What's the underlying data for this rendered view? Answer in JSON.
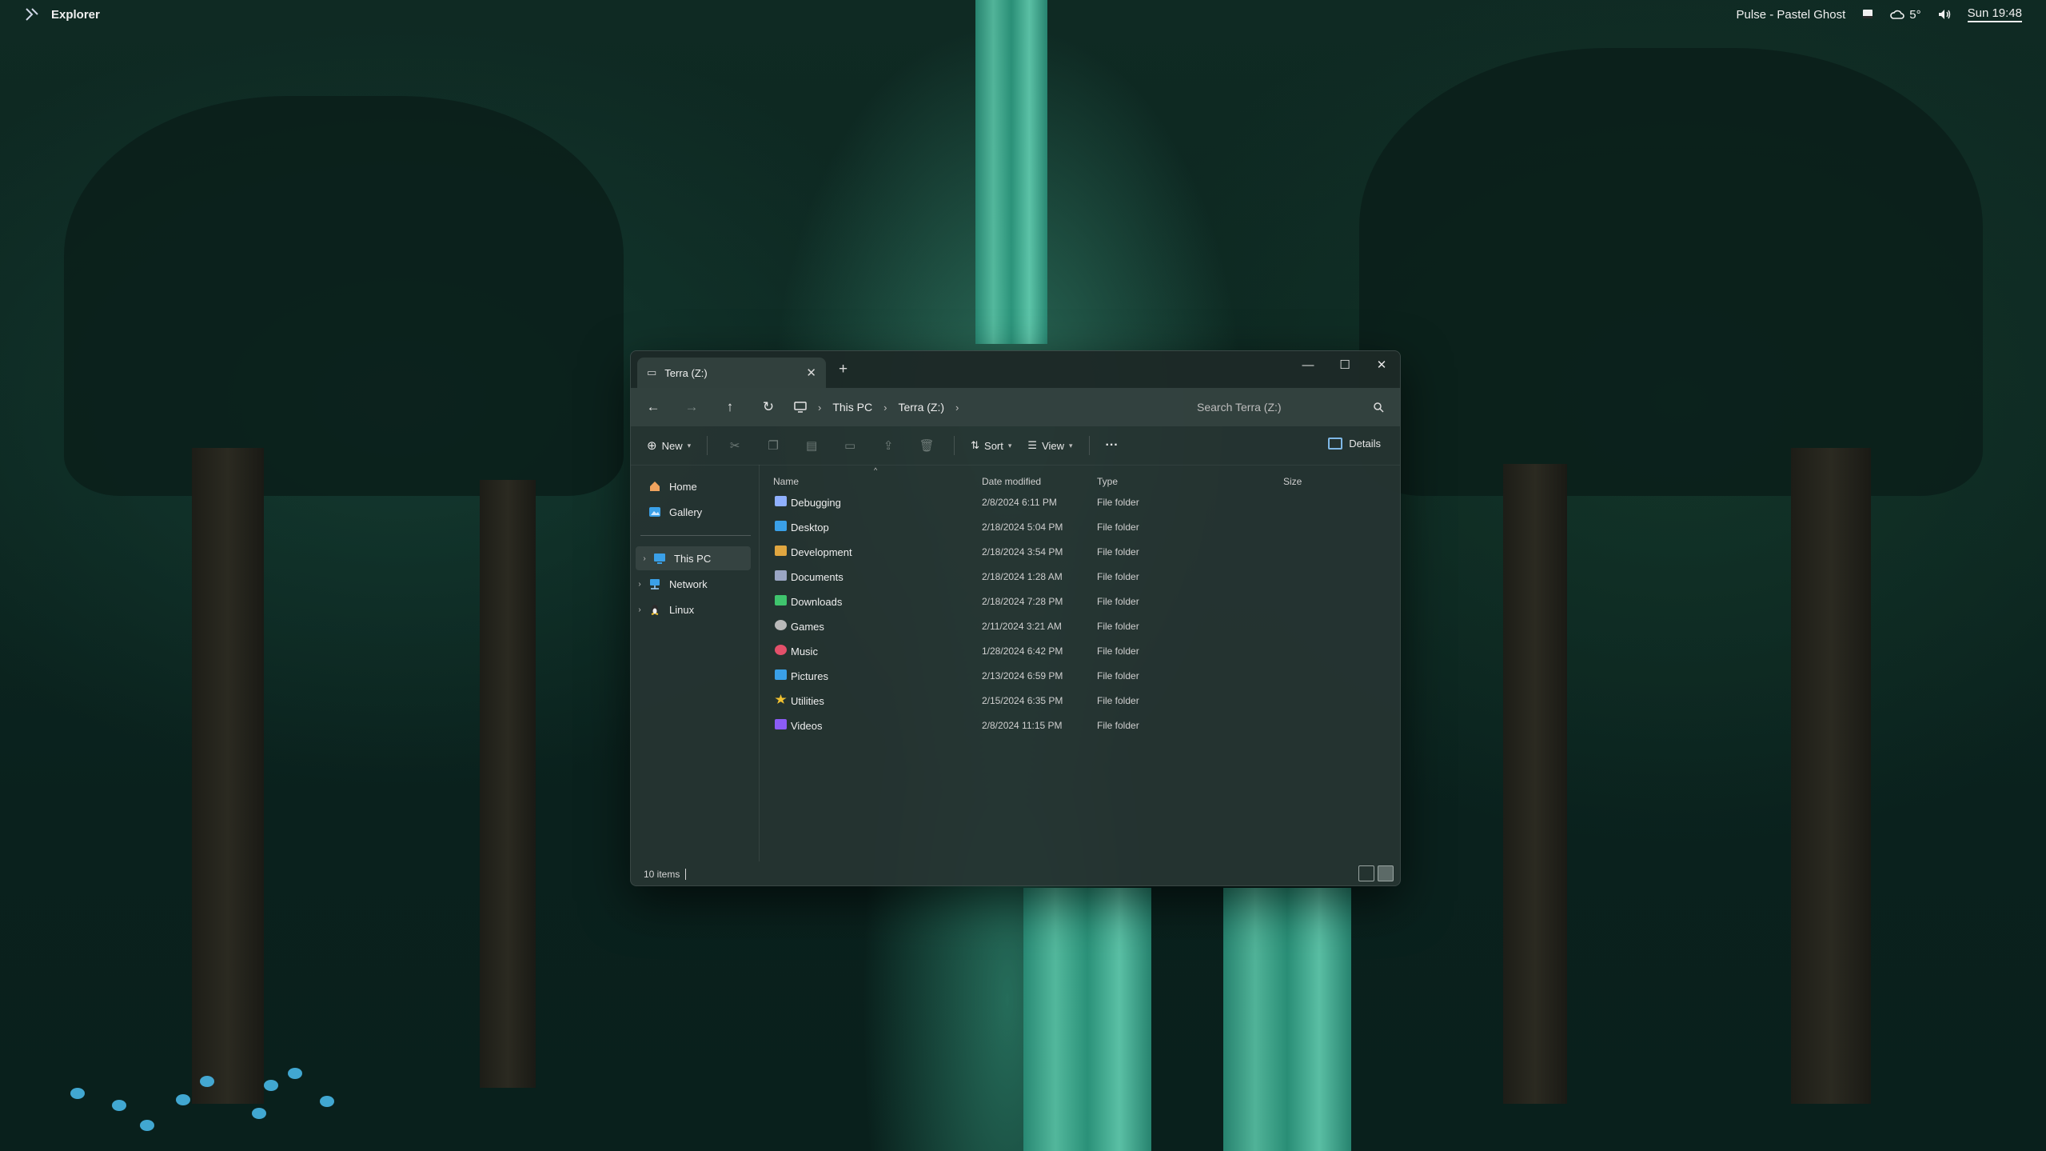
{
  "topbar": {
    "app_title": "Explorer",
    "now_playing": "Pulse - Pastel Ghost",
    "weather": "5°",
    "clock": "Sun 19:48"
  },
  "window": {
    "tab_title": "Terra (Z:)",
    "breadcrumb": [
      "This PC",
      "Terra (Z:)"
    ],
    "search_placeholder": "Search Terra (Z:)"
  },
  "toolbar": {
    "new_label": "New",
    "sort_label": "Sort",
    "view_label": "View",
    "more_label": "···",
    "details_label": "Details"
  },
  "sidebar": {
    "items": [
      {
        "label": "Home",
        "icon": "home-icon",
        "color": "#f0a35e"
      },
      {
        "label": "Gallery",
        "icon": "gallery-icon",
        "color": "#3aa0e8"
      },
      {
        "label": "This PC",
        "icon": "computer-icon",
        "color": "#3aa0e8"
      },
      {
        "label": "Network",
        "icon": "network-icon",
        "color": "#3aa0e8"
      },
      {
        "label": "Linux",
        "icon": "linux-icon",
        "color": "#f2c230"
      }
    ]
  },
  "columns": {
    "name": "Name",
    "date": "Date modified",
    "type": "Type",
    "size": "Size"
  },
  "files": [
    {
      "name": "Debugging",
      "date": "2/8/2024 6:11 PM",
      "type": "File folder",
      "icon": "debug-folder-icon",
      "color": "#8fb0ff"
    },
    {
      "name": "Desktop",
      "date": "2/18/2024 5:04 PM",
      "type": "File folder",
      "icon": "desktop-folder-icon",
      "color": "#3aa0e8"
    },
    {
      "name": "Development",
      "date": "2/18/2024 3:54 PM",
      "type": "File folder",
      "icon": "development-folder-icon",
      "color": "#e0a640"
    },
    {
      "name": "Documents",
      "date": "2/18/2024 1:28 AM",
      "type": "File folder",
      "icon": "documents-folder-icon",
      "color": "#9aa6c4"
    },
    {
      "name": "Downloads",
      "date": "2/18/2024 7:28 PM",
      "type": "File folder",
      "icon": "downloads-folder-icon",
      "color": "#3fc46d"
    },
    {
      "name": "Games",
      "date": "2/11/2024 3:21 AM",
      "type": "File folder",
      "icon": "games-folder-icon",
      "color": "#b9b9b9"
    },
    {
      "name": "Music",
      "date": "1/28/2024 6:42 PM",
      "type": "File folder",
      "icon": "music-folder-icon",
      "color": "#e3506a"
    },
    {
      "name": "Pictures",
      "date": "2/13/2024 6:59 PM",
      "type": "File folder",
      "icon": "pictures-folder-icon",
      "color": "#3aa0e8"
    },
    {
      "name": "Utilities",
      "date": "2/15/2024 6:35 PM",
      "type": "File folder",
      "icon": "utilities-folder-icon",
      "color": "#f2c230"
    },
    {
      "name": "Videos",
      "date": "2/8/2024 11:15 PM",
      "type": "File folder",
      "icon": "videos-folder-icon",
      "color": "#8b5cf6"
    }
  ],
  "status": {
    "item_count": "10 items"
  }
}
